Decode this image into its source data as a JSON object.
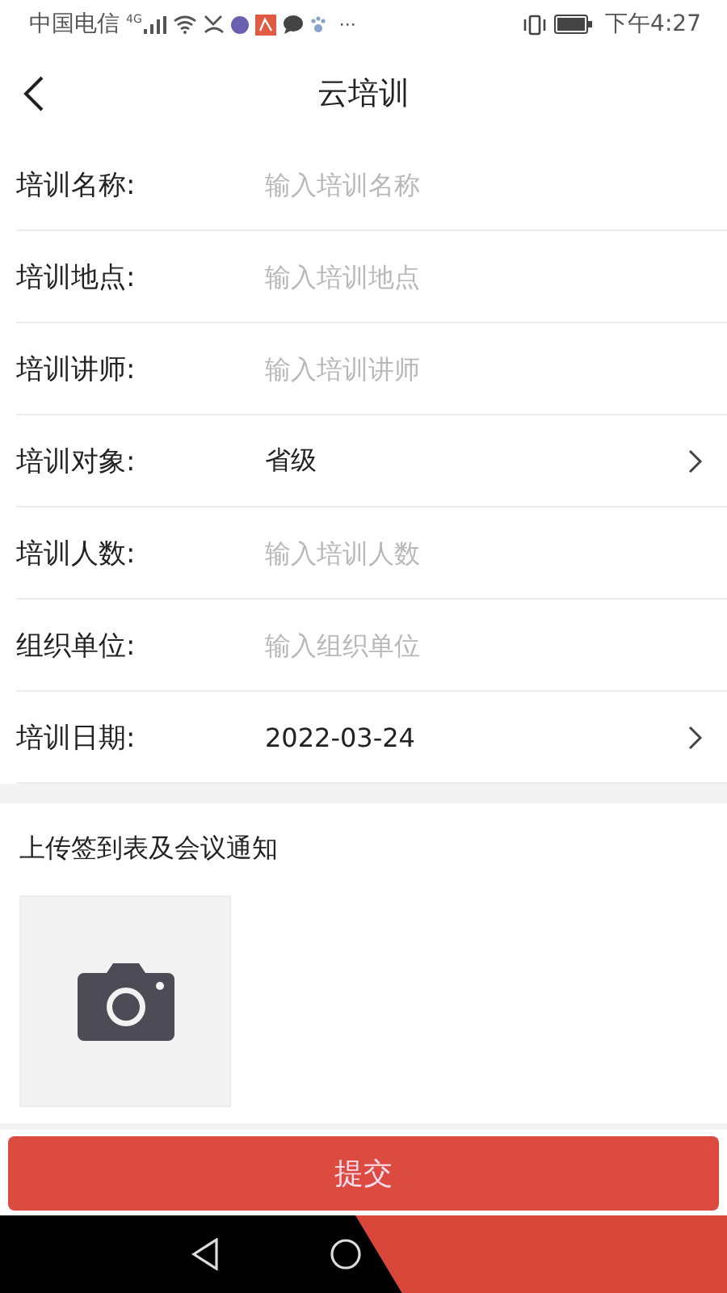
{
  "status_bar": {
    "carrier": "中国电信",
    "network": "4G",
    "more": "···",
    "time": "下午4:27"
  },
  "header": {
    "title": "云培训"
  },
  "fields": [
    {
      "kind": "input",
      "label": "培训名称:",
      "placeholder": "输入培训名称"
    },
    {
      "kind": "input",
      "label": "培训地点:",
      "placeholder": "输入培训地点"
    },
    {
      "kind": "input",
      "label": "培训讲师:",
      "placeholder": "输入培训讲师"
    },
    {
      "kind": "select",
      "label": "培训对象:",
      "value": "省级"
    },
    {
      "kind": "input",
      "label": "培训人数:",
      "placeholder": "输入培训人数"
    },
    {
      "kind": "input",
      "label": "组织单位:",
      "placeholder": "输入组织单位"
    },
    {
      "kind": "select",
      "label": "培训日期:",
      "value": "2022-03-24"
    }
  ],
  "upload": {
    "title": "上传签到表及会议通知"
  },
  "submit": {
    "label": "提交"
  }
}
